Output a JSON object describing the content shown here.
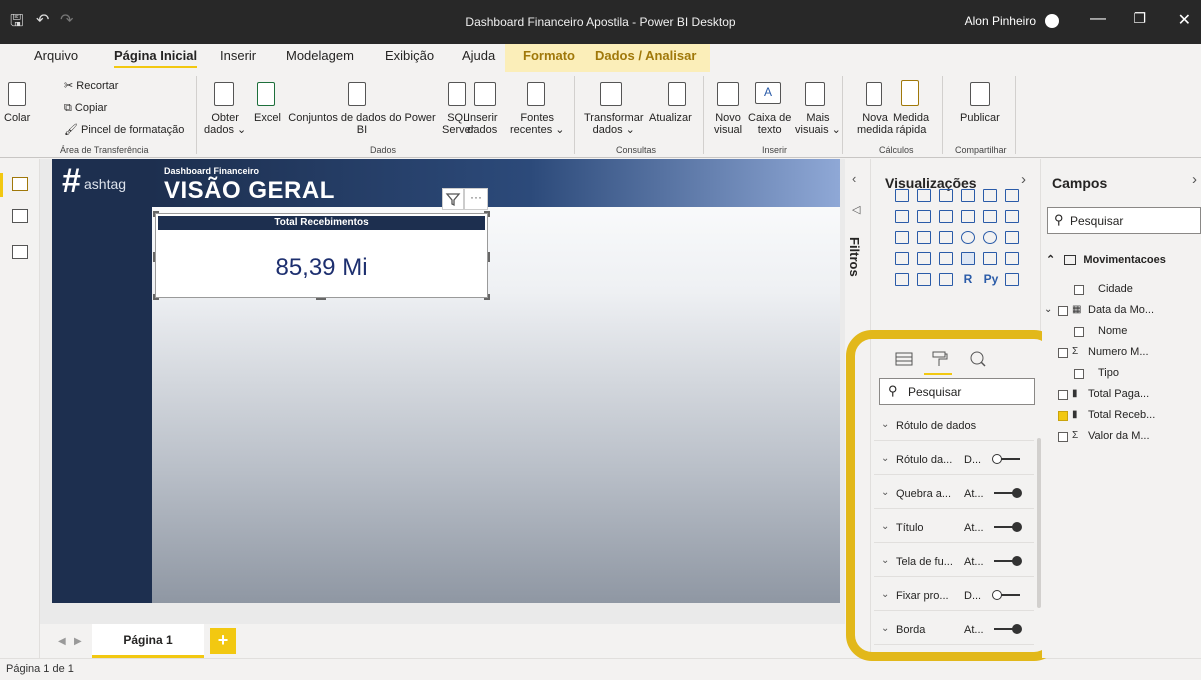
{
  "window": {
    "title": "Dashboard Financeiro Apostila - Power BI Desktop",
    "user": "Alon Pinheiro",
    "minimize": "—",
    "restore": "❐",
    "close": "✕"
  },
  "menu_tabs": [
    "Arquivo",
    "Página Inicial",
    "Inserir",
    "Modelagem",
    "Exibição",
    "Ajuda",
    "Formato",
    "Dados / Analisar"
  ],
  "ribbon": {
    "clipboard": {
      "paste": "Colar",
      "cut": "Recortar",
      "copy": "Copiar",
      "format_painter": "Pincel de formatação",
      "group": "Área de Transferência"
    },
    "data": {
      "get_data": "Obter",
      "get_data2": "dados ⌄",
      "excel": "Excel",
      "datasets": "Conjuntos de dados do Power",
      "datasets2": "BI",
      "sql": "SQL",
      "sql2": "Server",
      "enter_data": "Inserir",
      "enter_data2": "dados",
      "recent": "Fontes",
      "recent2": "recentes ⌄",
      "group": "Dados"
    },
    "queries": {
      "transform": "Transformar",
      "transform2": "dados ⌄",
      "refresh": "Atualizar",
      "group": "Consultas"
    },
    "insert": {
      "new_visual": "Novo",
      "new_visual2": "visual",
      "text_box": "Caixa de",
      "text_box2": "texto",
      "more_visuals": "Mais",
      "more_visuals2": "visuais ⌄",
      "group": "Inserir"
    },
    "calc": {
      "new_measure": "Nova",
      "new_measure2": "medida",
      "quick_measure": "Medida",
      "quick_measure2": "rápida",
      "group": "Cálculos"
    },
    "share": {
      "publish": "Publicar",
      "group": "Compartilhar"
    }
  },
  "report": {
    "logo_text": "ashtag",
    "header_small": "Dashboard Financeiro",
    "header_big": "VISÃO GERAL",
    "card_title": "Total Recebimentos",
    "card_value": "85,39 Mi",
    "more": "···"
  },
  "pages": {
    "tab": "Página 1",
    "add": "+",
    "status": "Página 1 de 1"
  },
  "filters": {
    "label": "Filtros"
  },
  "visualizations": {
    "title": "Visualizações",
    "search_placeholder": "Pesquisar",
    "r_label": "R",
    "py_label": "Py",
    "format_rows": [
      {
        "label": "Rótulo de dados",
        "value": "",
        "toggle": "none"
      },
      {
        "label": "Rótulo da...",
        "value": "D...",
        "toggle": "off"
      },
      {
        "label": "Quebra a...",
        "value": "At...",
        "toggle": "on"
      },
      {
        "label": "Título",
        "value": "At...",
        "toggle": "on"
      },
      {
        "label": "Tela de fu...",
        "value": "At...",
        "toggle": "on"
      },
      {
        "label": "Fixar pro...",
        "value": "D...",
        "toggle": "off"
      },
      {
        "label": "Borda",
        "value": "At...",
        "toggle": "on"
      }
    ]
  },
  "fields": {
    "title": "Campos",
    "search_placeholder": "Pesquisar",
    "table": "Movimentacoes",
    "items": [
      {
        "name": "Cidade",
        "checked": false,
        "sym": ""
      },
      {
        "name": "Data da Mo...",
        "checked": false,
        "sym": "▦"
      },
      {
        "name": "Nome",
        "checked": false,
        "sym": ""
      },
      {
        "name": "Numero M...",
        "checked": false,
        "sym": "Σ"
      },
      {
        "name": "Tipo",
        "checked": false,
        "sym": ""
      },
      {
        "name": "Total Paga...",
        "checked": false,
        "sym": "▮"
      },
      {
        "name": "Total Receb...",
        "checked": true,
        "sym": "▮"
      },
      {
        "name": "Valor da M...",
        "checked": false,
        "sym": "Σ"
      }
    ]
  },
  "colors": {
    "accent": "#f2c811",
    "navy": "#1d2f4f",
    "highlight": "#e2b81a"
  }
}
